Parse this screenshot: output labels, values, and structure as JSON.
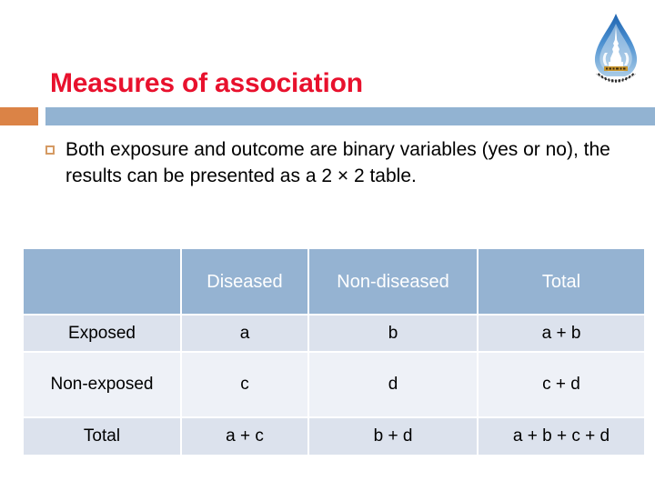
{
  "slide": {
    "title": "Measures of association",
    "bullet": {
      "marker": "square-outline-bullet",
      "text": "Both exposure and outcome are binary variables (yes or no), the results can be presented as a 2 × 2 table."
    }
  },
  "logo": {
    "name": "naresuan-university-logo",
    "alt": "University emblem"
  },
  "table": {
    "headers": [
      "",
      "Diseased",
      "Non-diseased",
      "Total"
    ],
    "rows": [
      {
        "label": "Exposed",
        "diseased": "a",
        "nondiseased": "b",
        "total": "a + b"
      },
      {
        "label": "Non-exposed",
        "diseased": "c",
        "nondiseased": "d",
        "total": "c + d"
      },
      {
        "label": "Total",
        "diseased": "a + c",
        "nondiseased": "b + d",
        "total": "a + b + c + d"
      }
    ]
  },
  "colors": {
    "title_red": "#e8112d",
    "bar_orange": "#db8346",
    "bar_blue": "#92b3d2",
    "header_blue": "#95b3d2",
    "row_band_dark": "#dce2ed",
    "row_band_light": "#eef1f7",
    "bullet_orange": "#d59a63"
  }
}
